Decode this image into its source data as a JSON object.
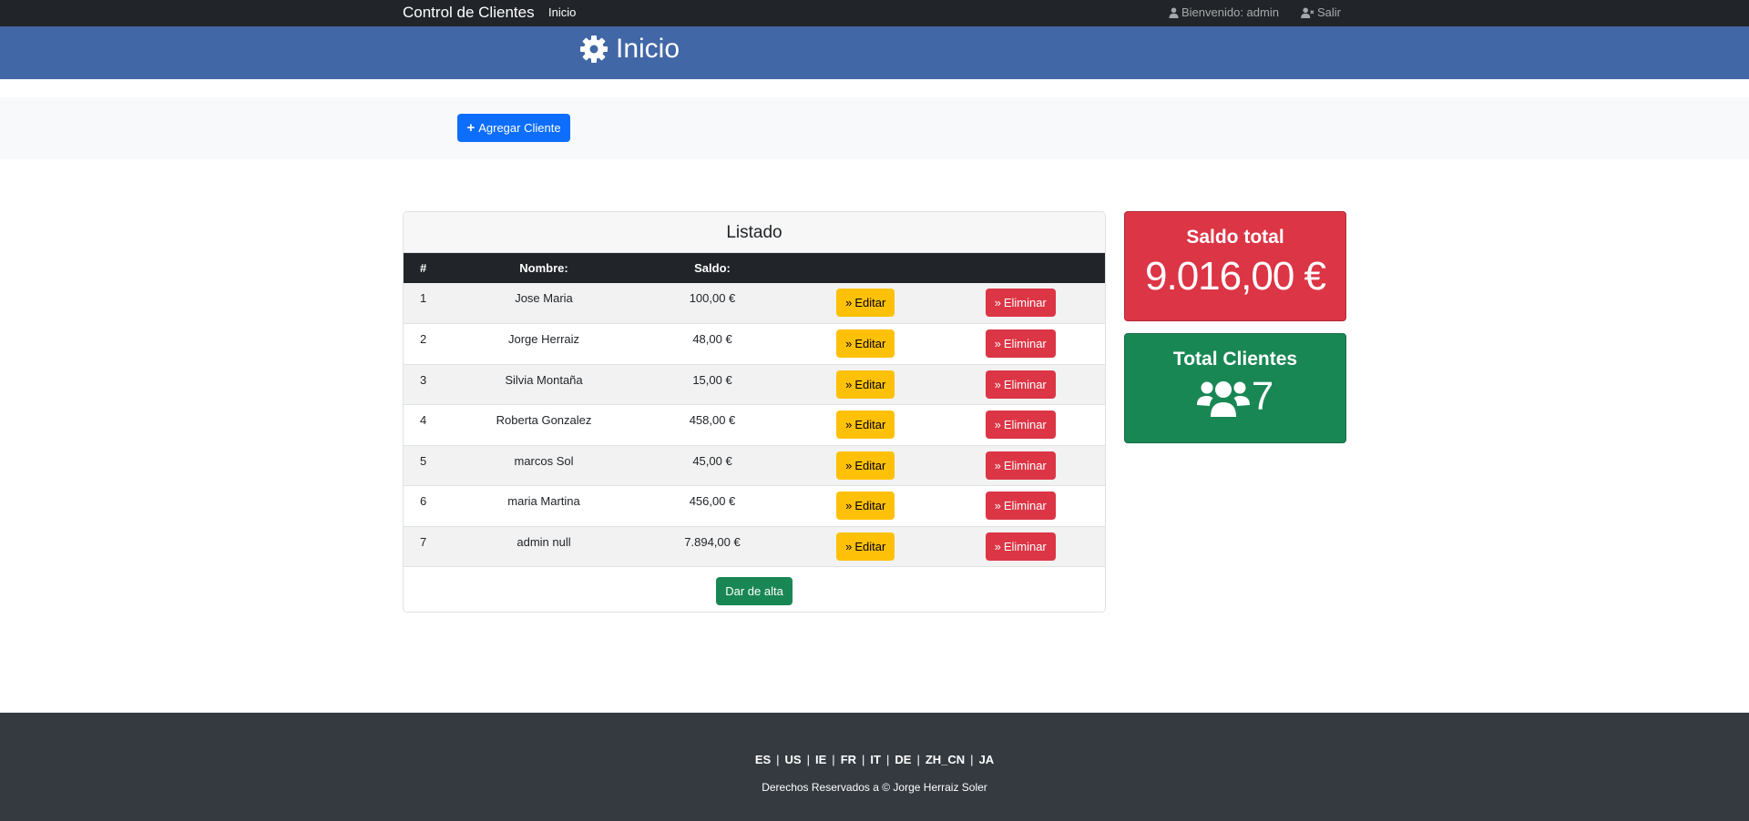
{
  "nav": {
    "brand": "Control de Clientes",
    "home_link": "Inicio",
    "user_label": "Bienvenido: admin",
    "logout_label": "Salir"
  },
  "header": {
    "title": "Inicio"
  },
  "actions": {
    "add_client": "Agregar Cliente"
  },
  "listado": {
    "title": "Listado",
    "columns": [
      "#",
      "Nombre:",
      "Saldo:"
    ],
    "edit_label": "Editar",
    "delete_label": "Eliminar",
    "footer_button": "Dar de alta",
    "rows": [
      {
        "id": "1",
        "nombre": "Jose Maria",
        "saldo": "100,00 €"
      },
      {
        "id": "2",
        "nombre": "Jorge Herraiz",
        "saldo": "48,00 €"
      },
      {
        "id": "3",
        "nombre": "Silvia Montaña",
        "saldo": "15,00 €"
      },
      {
        "id": "4",
        "nombre": "Roberta Gonzalez",
        "saldo": "458,00 €"
      },
      {
        "id": "5",
        "nombre": "marcos Sol",
        "saldo": "45,00 €"
      },
      {
        "id": "6",
        "nombre": "maria Martina",
        "saldo": "456,00 €"
      },
      {
        "id": "7",
        "nombre": "admin null",
        "saldo": "7.894,00 €"
      }
    ]
  },
  "stats": {
    "saldo_title": "Saldo total",
    "saldo_value": "9.016,00 €",
    "clientes_title": "Total Clientes",
    "clientes_value": "7"
  },
  "footer": {
    "languages": [
      "ES",
      "US",
      "IE",
      "FR",
      "IT",
      "DE",
      "ZH_CN",
      "JA"
    ],
    "rights": "Derechos Reservados a © Jorge Herraiz Soler"
  },
  "colors": {
    "navbar": "#212529",
    "header": "#4267a6",
    "primary": "#0d6efd",
    "warning": "#ffc107",
    "danger": "#dc3545",
    "success": "#198754",
    "footer": "#343a40"
  }
}
